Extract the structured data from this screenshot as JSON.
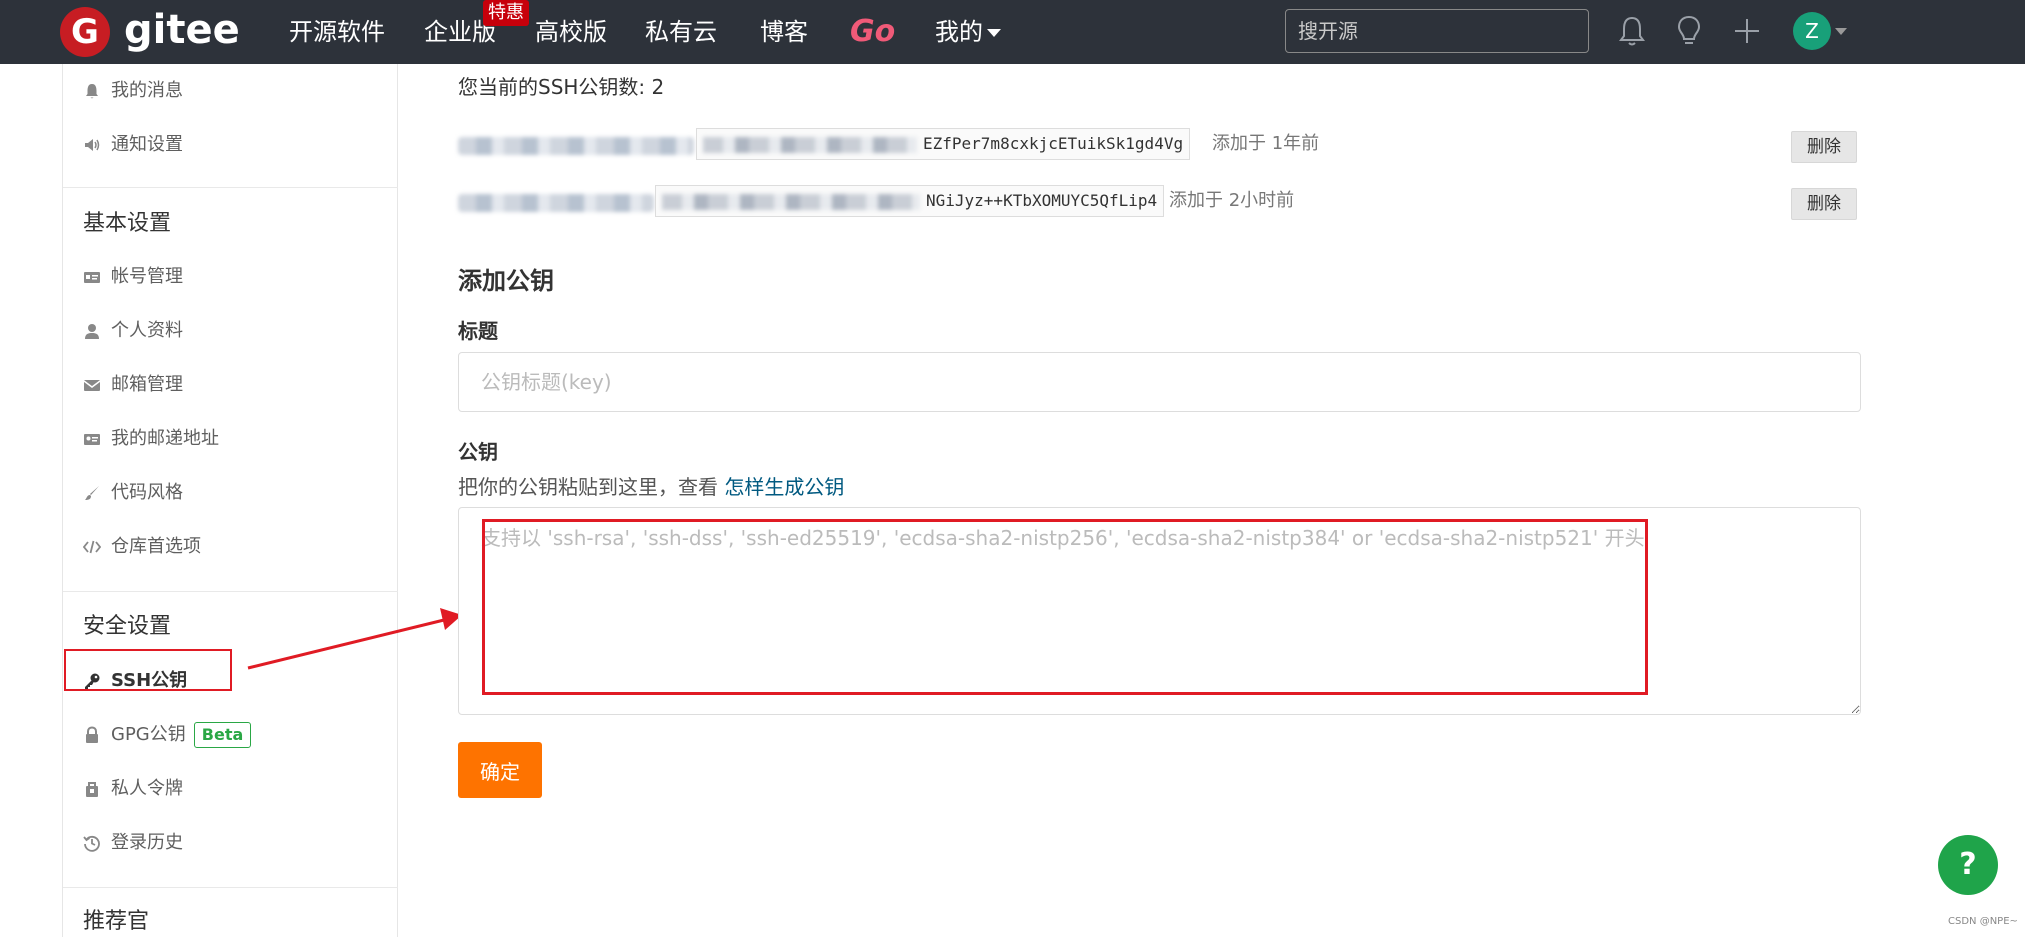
{
  "header": {
    "logo_text": "gitee",
    "nav": [
      {
        "label": "开源软件"
      },
      {
        "label": "企业版",
        "badge": "特惠"
      },
      {
        "label": "高校版"
      },
      {
        "label": "私有云"
      },
      {
        "label": "博客"
      },
      {
        "label": "Go"
      },
      {
        "label": "我的"
      }
    ],
    "search_placeholder": "搜开源",
    "avatar_letter": "Z",
    "icons": [
      "bell-icon",
      "lightbulb-icon",
      "plus-icon"
    ]
  },
  "sidebar": {
    "top_items": [
      {
        "label": "我的消息",
        "icon": "bell-icon"
      },
      {
        "label": "通知设置",
        "icon": "speaker-icon"
      }
    ],
    "basic_title": "基本设置",
    "basic_items": [
      {
        "label": "帐号管理",
        "icon": "id-card-icon"
      },
      {
        "label": "个人资料",
        "icon": "user-icon"
      },
      {
        "label": "邮箱管理",
        "icon": "envelope-icon"
      },
      {
        "label": "我的邮递地址",
        "icon": "address-card-icon"
      },
      {
        "label": "代码风格",
        "icon": "brush-icon"
      },
      {
        "label": "仓库首选项",
        "icon": "code-icon"
      }
    ],
    "security_title": "安全设置",
    "security_items": [
      {
        "label": "SSH公钥",
        "icon": "key-icon",
        "active": true
      },
      {
        "label": "GPG公钥",
        "icon": "lock-icon",
        "badge": "Beta"
      },
      {
        "label": "私人令牌",
        "icon": "token-icon"
      },
      {
        "label": "登录历史",
        "icon": "history-icon"
      }
    ],
    "recommend_title": "推荐官"
  },
  "main": {
    "key_count_text": "您当前的SSH公钥数: 2",
    "keys": [
      {
        "fingerprint_tail": "EZfPer7m8cxkjcETuikSk1gd4Vg",
        "added": "添加于 1年前",
        "delete_label": "删除"
      },
      {
        "fingerprint_tail": "NGiJyz++KTbXOMUYC5QfLip4",
        "added": "添加于 2小时前",
        "delete_label": "删除"
      }
    ],
    "add_title": "添加公钥",
    "title_label": "标题",
    "title_placeholder": "公钥标题(key)",
    "key_label": "公钥",
    "key_help_prefix": "把你的公钥粘贴到这里，查看 ",
    "key_help_link": "怎样生成公钥",
    "key_placeholder": "支持以 'ssh-rsa', 'ssh-dss', 'ssh-ed25519', 'ecdsa-sha2-nistp256', 'ecdsa-sha2-nistp384' or 'ecdsa-sha2-nistp521' 开头",
    "submit_label": "确定"
  },
  "fab": {
    "label": "?"
  },
  "watermark": "CSDN @NPE~",
  "colors": {
    "topbar": "#2d323a",
    "brand_red": "#c71d23",
    "submit_orange": "#fe7300",
    "annotation_red": "#e01b24",
    "go_pink": "#f05a78",
    "beta_green": "#2aa745"
  }
}
